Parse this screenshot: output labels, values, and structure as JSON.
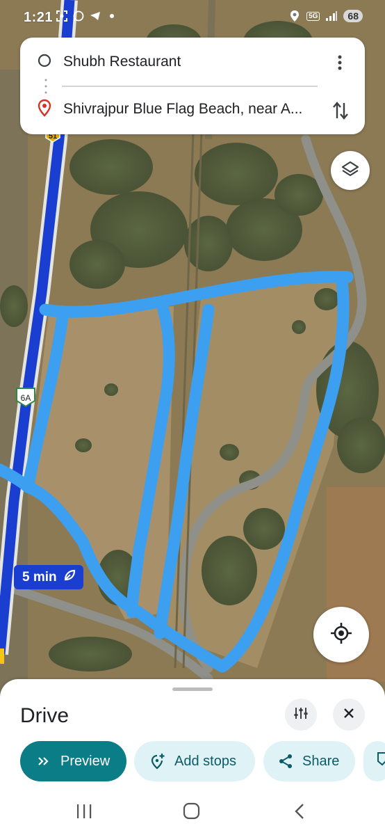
{
  "status_bar": {
    "time": "1:21",
    "network": "5G",
    "battery": "68"
  },
  "route": {
    "origin": "Shubh Restaurant",
    "destination": "Shivrajpur Blue Flag Beach, near A..."
  },
  "map": {
    "route_shield_top": "51",
    "route_shield_side": "6A",
    "eta": "5 min",
    "route_color": "#1a3fd0",
    "drawn_path_color": "#3d9ff0",
    "terrain_color": "#8a7a55"
  },
  "sheet": {
    "mode_title": "Drive",
    "chips": {
      "preview": "Preview",
      "add_stops": "Add stops",
      "share": "Share"
    }
  },
  "icons": {
    "origin": "circle-outline-icon",
    "destination": "map-pin-icon",
    "more": "more-vertical-icon",
    "swap": "swap-vertical-icon",
    "layers": "layers-icon",
    "locate": "my-location-icon",
    "leaf": "eco-leaf-icon",
    "options": "tune-icon",
    "close": "close-icon"
  }
}
